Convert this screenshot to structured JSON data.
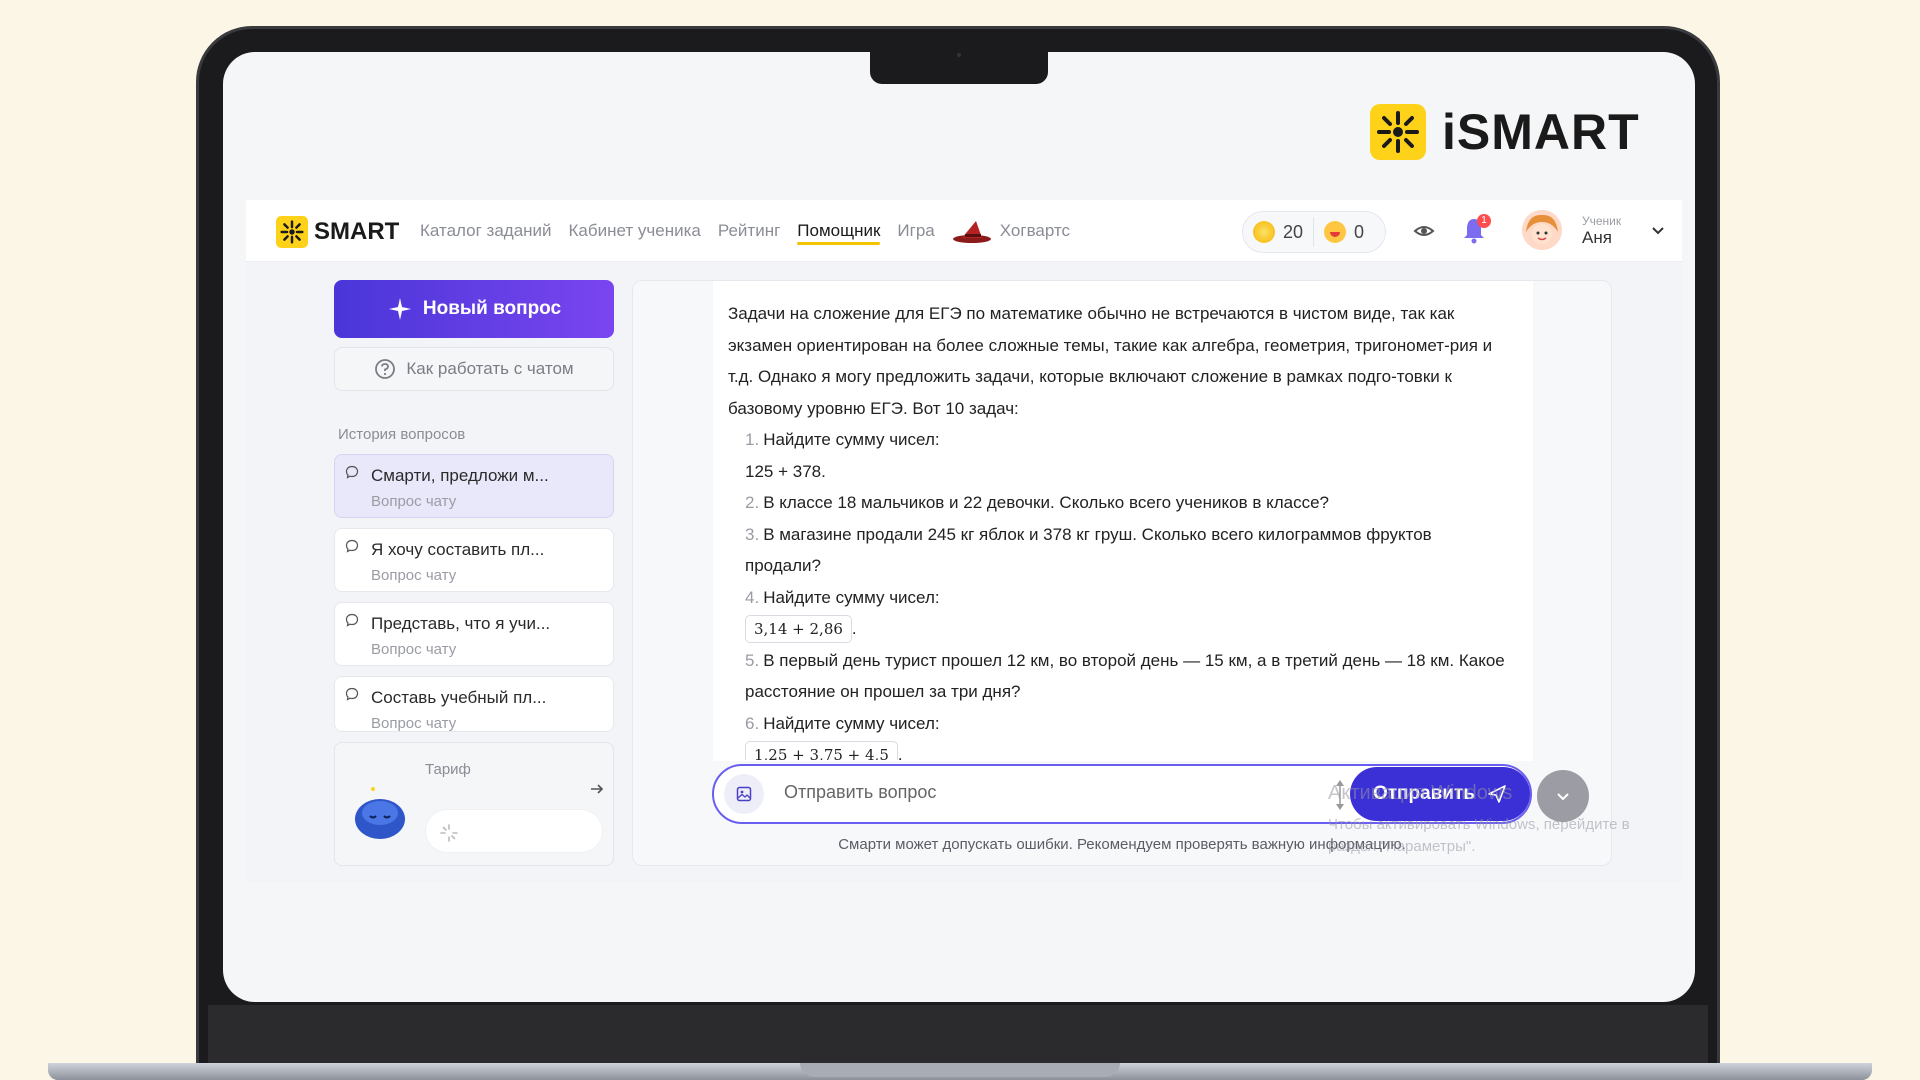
{
  "brand": {
    "big_name": "iSMART",
    "small_name": "SMART"
  },
  "nav": {
    "items": [
      "Каталог заданий",
      "Кабинет ученика",
      "Рейтинг",
      "Помощник",
      "Игра"
    ],
    "active": "Помощник",
    "hogwarts": "Хогвартс"
  },
  "counters": {
    "coins": "20",
    "smiles": "0"
  },
  "notifications": {
    "badge": "1"
  },
  "user": {
    "role": "Ученик",
    "name": "Аня"
  },
  "sidebar": {
    "new_question": "Новый вопрос",
    "how_it_works": "Как работать с чатом",
    "history_title": "История вопросов",
    "history": [
      {
        "title": "Смарти, предложи м...",
        "sub": "Вопрос чату"
      },
      {
        "title": "Я хочу составить пл...",
        "sub": "Вопрос чату"
      },
      {
        "title": "Представь, что я учи...",
        "sub": "Вопрос чату"
      },
      {
        "title": "Составь учебный пл...",
        "sub": "Вопрос чату"
      }
    ],
    "tariff_label": "Тариф"
  },
  "answer": {
    "intro": "Задачи на сложение для ЕГЭ по математике обычно не встречаются в чистом виде, так как экзамен ориентирован на более сложные темы, такие как алгебра, геометрия, тригономет-рия и т.д. Однако я могу предложить задачи, которые включают сложение в рамках подго-товки к базовому уровню ЕГЭ. Вот 10 задач:",
    "items": [
      {
        "num": "1.",
        "text": "Найдите сумму чисел:",
        "extra": "125 + 378."
      },
      {
        "num": "2.",
        "text": "В классе 18 мальчиков и 22 девочки. Сколько всего учеников в классе?"
      },
      {
        "num": "3.",
        "text": "В магазине продали 245 кг яблок и 378 кг груш. Сколько всего килограммов фруктов продали?"
      },
      {
        "num": "4.",
        "text": "Найдите сумму чисел:",
        "math": "3,14 + 2,86"
      },
      {
        "num": "5.",
        "text": "В первый день турист прошел 12 км, во второй день — 15 км, а в третий день — 18 км. Какое расстояние он прошел за три дня?"
      },
      {
        "num": "6.",
        "text": "Найдите сумму чисел:",
        "math": "1,25 + 3,75 + 4,5"
      }
    ]
  },
  "input": {
    "placeholder": "Отправить вопрос",
    "send": "Отправить"
  },
  "disclaimer": "Смарти может допускать ошибки. Рекомендуем проверять важную информацию.",
  "watermark": {
    "line1": "Активация Windows",
    "line2": "Чтобы активировать Windows, перейдите в раздел \"Параметры\"."
  },
  "colors": {
    "accent": "#3b2fd6",
    "brand_yellow": "#ffd21a",
    "background": "#fbf6e6"
  }
}
